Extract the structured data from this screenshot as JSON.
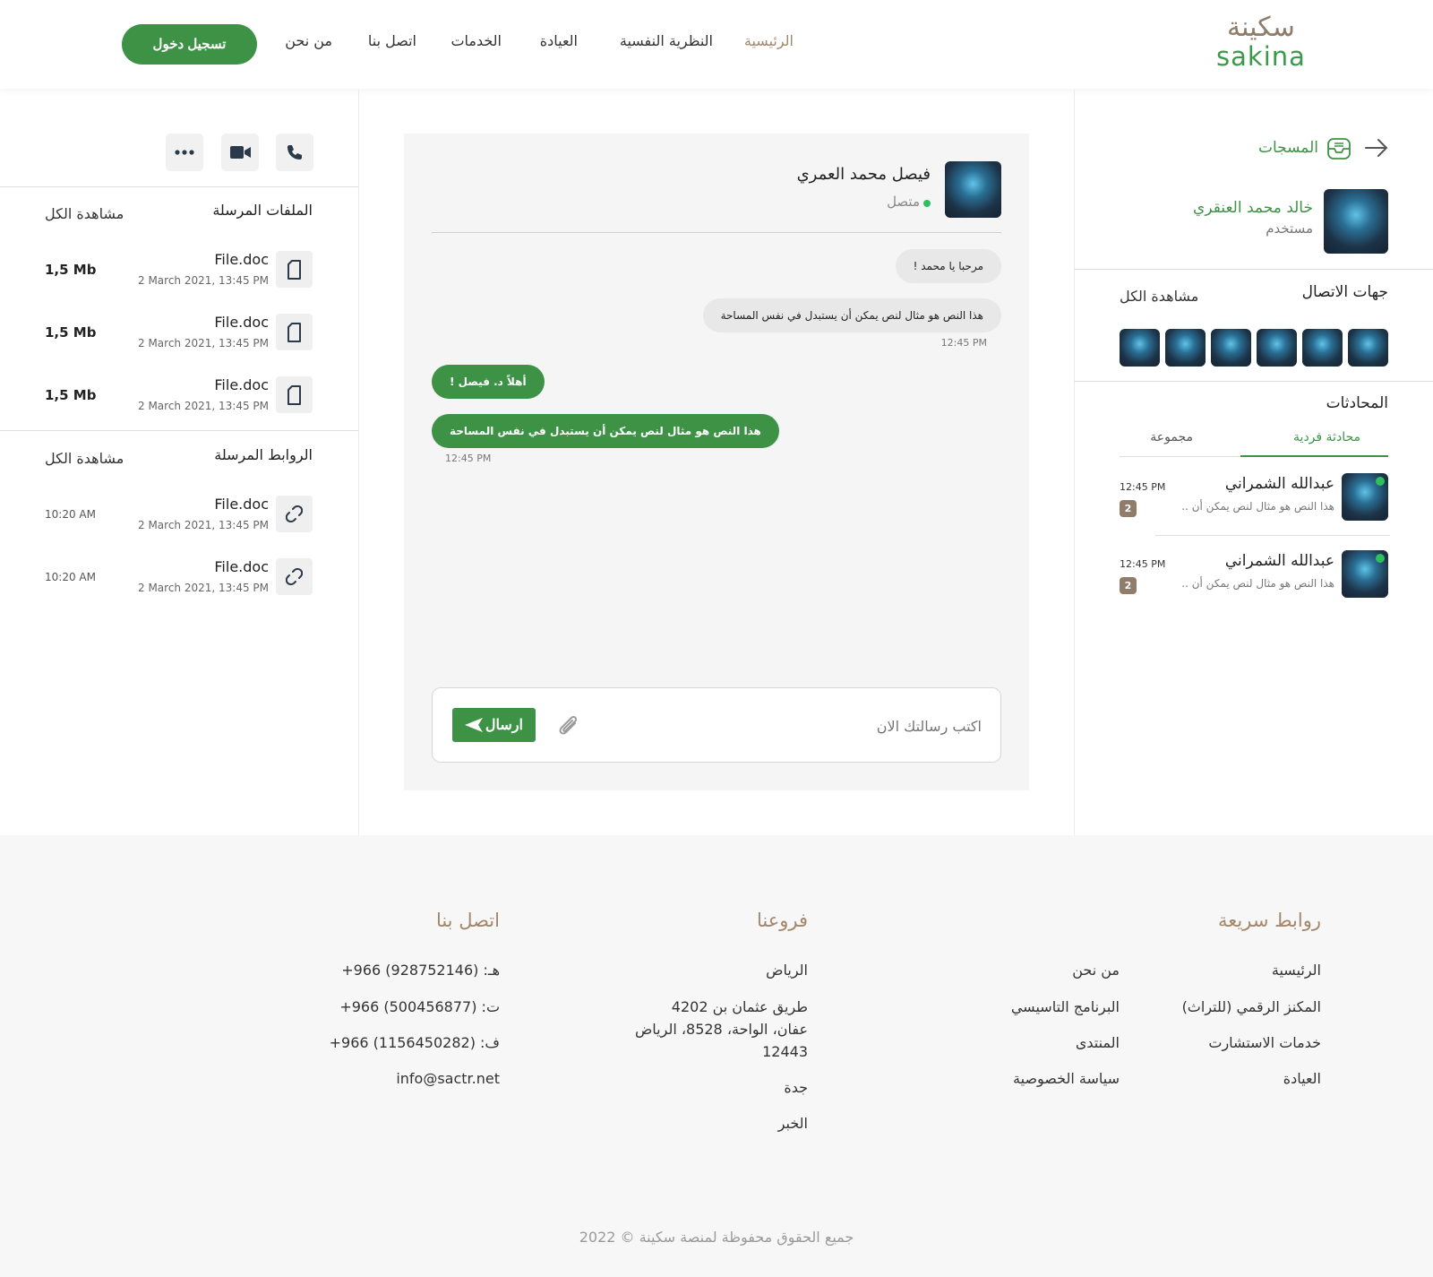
{
  "header": {
    "logo_ar": "سكينة",
    "logo_en": "sakina",
    "nav": [
      "الرئيسية",
      "النظرية النفسية",
      "العيادة",
      "الخدمات",
      "اتصل بنا",
      "من نحن"
    ],
    "login_label": "تسجيل دخول"
  },
  "right": {
    "title": "المسجات",
    "user_name": "خالد محمد العنقري",
    "user_role": "مستخدم",
    "contacts_title": "جهات الاتصال",
    "view_all": "مشاهدة الكل",
    "conversations_title": "المحادثات",
    "tab_single": "محادثة فردية",
    "tab_group": "مجموعة",
    "conversations": [
      {
        "name": "عبدالله الشمراني",
        "preview": "هذا النص هو مثال لنص يمكن أن ..",
        "time": "12:45 PM",
        "unread": "2"
      },
      {
        "name": "عبدالله الشمراني",
        "preview": "هذا النص هو مثال لنص يمكن أن ..",
        "time": "12:45 PM",
        "unread": "2"
      }
    ]
  },
  "chat": {
    "contact_name": "فيصل محمد العمري",
    "status": "متصل",
    "messages": [
      {
        "text": "مرحبا يا محمد !"
      },
      {
        "text": "هذا النص هو مثال لنص يمكن أن يستبدل في نفس المساحة",
        "time": "12:45 PM"
      },
      {
        "text": "أهلاً د. فيصل !"
      },
      {
        "text": "هذا النص هو مثال لنص يمكن أن يستبدل في نفس المساحة",
        "time": "12:45 PM"
      }
    ],
    "input_placeholder": "اكتب رسالتك الان",
    "send_label": "ارسال"
  },
  "left": {
    "files_title": "الملفات المرسلة",
    "links_title": "الروابط المرسلة",
    "view_all": "مشاهدة الكل",
    "files": [
      {
        "name": "File.doc",
        "date": "2 March 2021, 13:45 PM",
        "size": "1,5 Mb"
      },
      {
        "name": "File.doc",
        "date": "2 March 2021, 13:45 PM",
        "size": "1,5 Mb"
      },
      {
        "name": "File.doc",
        "date": "2 March 2021, 13:45 PM",
        "size": "1,5 Mb"
      }
    ],
    "links": [
      {
        "name": "File.doc",
        "date": "2 March 2021, 13:45 PM",
        "time": "10:20 AM"
      },
      {
        "name": "File.doc",
        "date": "2 March 2021, 13:45 PM",
        "time": "10:20 AM"
      }
    ]
  },
  "footer": {
    "quick_links_title": "روابط سريعة",
    "quick_links_col1": [
      "الرئيسية",
      "المكنز الرقمي (للتراث)",
      "خدمات الاستشارت",
      "العيادة"
    ],
    "quick_links_col2": [
      "من نحن",
      "البرنامج التاسيسي",
      "المنتدى",
      "سياسة الخصوصية"
    ],
    "branches_title": "فروعنا",
    "branch_1": "الرياض",
    "address_1": "طريق عثمان بن 4202",
    "address_2": "عفان، الواحة، 8528، الرياض",
    "address_3": "12443",
    "branch_2": "جدة",
    "branch_3": "الخبر",
    "contact_title": "اتصل بنا",
    "phone_h": "هـ: (928752146) 966+",
    "phone_t": "ت: (500456877) 966+",
    "fax": "ف: (1156450282) 966+",
    "email": "info@sactr.net",
    "copyright": "2022 © جميع الحقوق محفوظة لمنصة سكينة"
  },
  "colors": {
    "brand_green": "#3e9246",
    "brand_brown": "#a3876c",
    "online": "#2fbf5f"
  }
}
